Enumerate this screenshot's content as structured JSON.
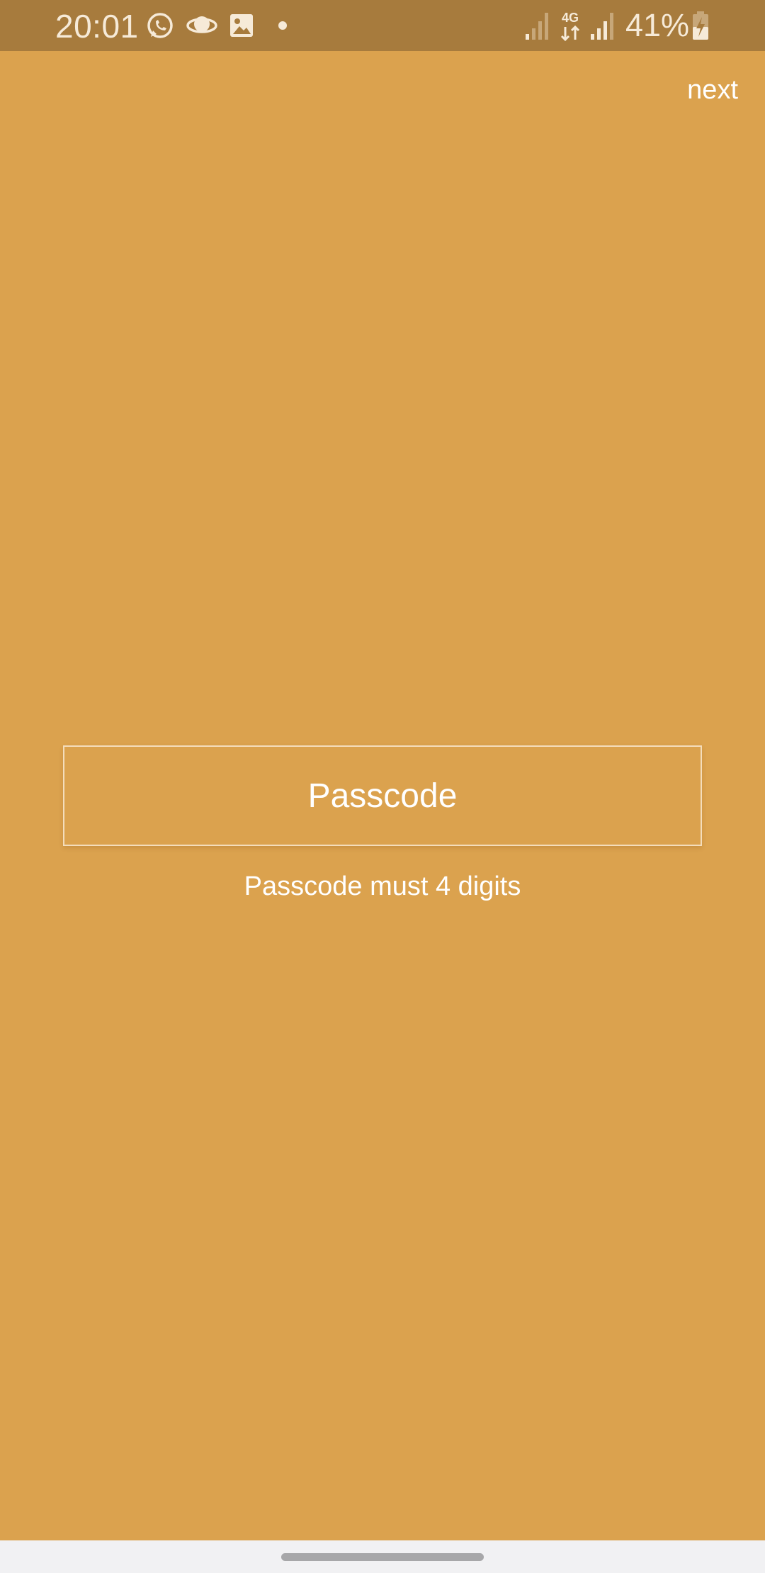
{
  "status_bar": {
    "time": "20:01",
    "network": "4G",
    "battery": "41%",
    "icons": [
      "whatsapp-icon",
      "saturn-icon",
      "gallery-icon",
      "dot-icon",
      "signal-weak-icon",
      "network-4g-icon",
      "signal-icon",
      "battery-charging-icon"
    ]
  },
  "header": {
    "next_label": "next"
  },
  "passcode": {
    "placeholder": "Passcode",
    "value": "",
    "hint": "Passcode must 4 digits"
  },
  "colors": {
    "background": "#dba24e",
    "status_bar": "#a77b3d",
    "text": "#ffffff",
    "nav_bar": "#f1f1f3"
  }
}
